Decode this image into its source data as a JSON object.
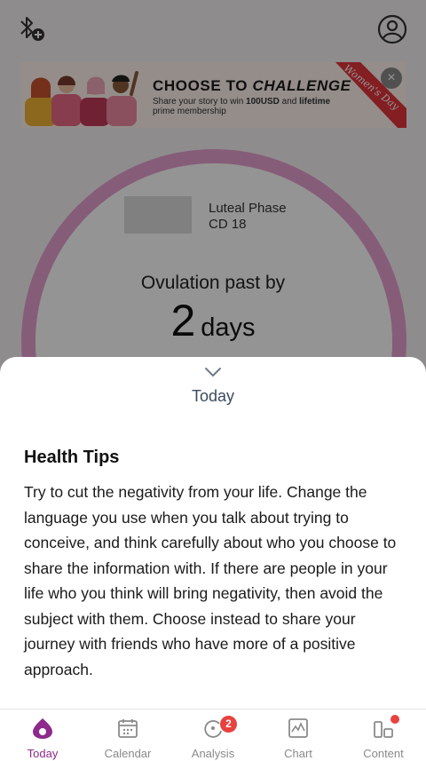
{
  "banner": {
    "title_prefix": "CHOOSE TO ",
    "title_emphasis": "CHALLENGE",
    "subtitle_1": "Share your story to win ",
    "subtitle_bold_1": "100USD",
    "subtitle_2": " and ",
    "subtitle_bold_2": "lifetime",
    "subtitle_3": "prime membership",
    "ribbon_text": "Women's Day",
    "close_glyph": "×"
  },
  "cycle": {
    "phase_name": "Luteal Phase",
    "cycle_day": "CD 18",
    "ovulation_label": "Ovulation past by",
    "ovulation_days": "2",
    "ovulation_unit": "days"
  },
  "sheet": {
    "title": "Today",
    "tips_heading": "Health Tips",
    "tips_body": "Try to cut the negativity from your life. Change the language you use when you talk about trying to conceive, and think carefully about who you choose to share the information with. If there are people in your life who you think will bring negativity, then avoid the subject with them. Choose instead to share your journey with friends who have more of a positive approach."
  },
  "nav": {
    "items": [
      {
        "label": "Today",
        "icon": "today-drop-icon",
        "active": true
      },
      {
        "label": "Calendar",
        "icon": "calendar-icon"
      },
      {
        "label": "Analysis",
        "icon": "analysis-cycle-icon",
        "badge": "2"
      },
      {
        "label": "Chart",
        "icon": "chart-icon"
      },
      {
        "label": "Content",
        "icon": "content-grid-icon",
        "dot": true
      }
    ]
  },
  "colors": {
    "accent": "#8e2a8c",
    "ring": "#e7a1cf",
    "badge": "#e8413f",
    "sheet_title": "#3b4a5e"
  }
}
